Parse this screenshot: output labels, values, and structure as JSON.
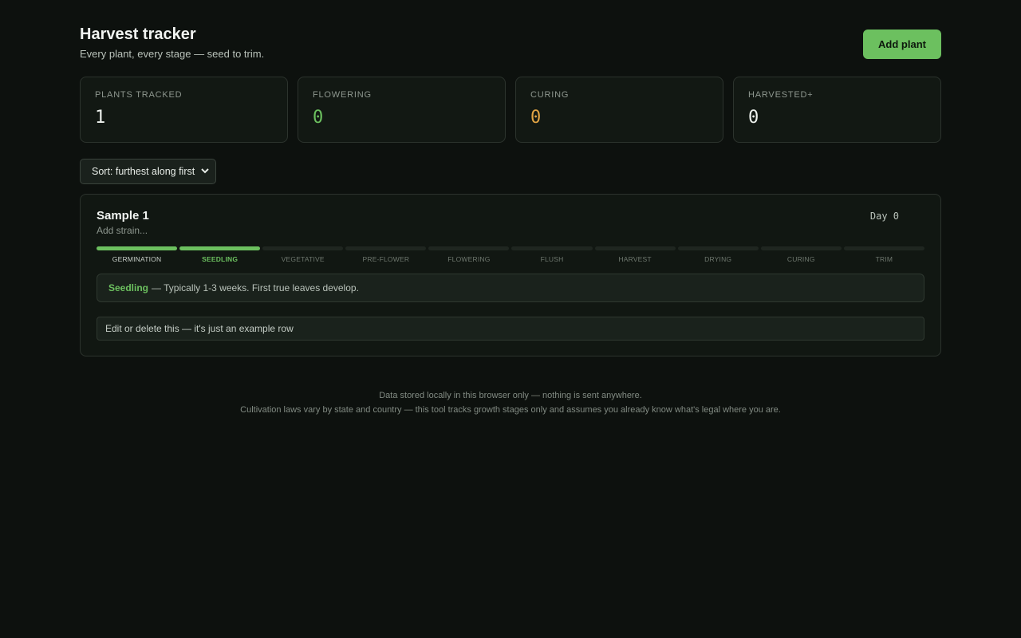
{
  "header": {
    "title": "Harvest tracker",
    "subtitle": "Every plant, every stage — seed to trim.",
    "add_button": "Add plant"
  },
  "stats": [
    {
      "label": "PLANTS TRACKED",
      "value": "1",
      "color": "#eef2ee"
    },
    {
      "label": "FLOWERING",
      "value": "0",
      "color": "#6cc05f"
    },
    {
      "label": "CURING",
      "value": "0",
      "color": "#e2a444"
    },
    {
      "label": "HARVESTED+",
      "value": "0",
      "color": "#eef2ee"
    }
  ],
  "sort": {
    "selected": "Sort: furthest along first"
  },
  "plant": {
    "name": "Sample 1",
    "strain_placeholder": "Add strain...",
    "day": "Day 0",
    "stages": [
      "GERMINATION",
      "SEEDLING",
      "VEGETATIVE",
      "PRE-FLOWER",
      "FLOWERING",
      "FLUSH",
      "HARVEST",
      "DRYING",
      "CURING",
      "TRIM"
    ],
    "completed_stages": 1,
    "current_stage": "Seedling",
    "stage_description": " — Typically 1-3 weeks. First true leaves develop.",
    "notes_value": "Edit or delete this — it's just an example row"
  },
  "footer": {
    "line1": "Data stored locally in this browser only — nothing is sent anywhere.",
    "line2": "Cultivation laws vary by state and country — this tool tracks growth stages only and assumes you already know what's legal where you are."
  },
  "colors": {
    "accent": "#6cc05f",
    "amber": "#e2a444",
    "background": "#0d110e"
  }
}
